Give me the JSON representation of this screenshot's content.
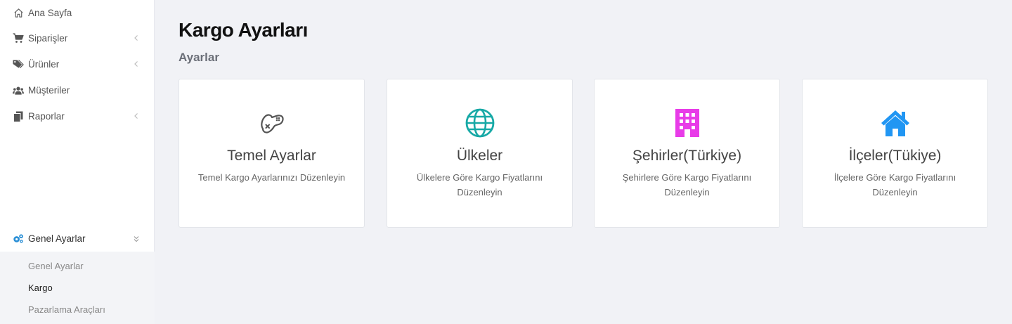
{
  "sidebar": {
    "items": [
      {
        "label": "Ana Sayfa",
        "icon": "home-icon"
      },
      {
        "label": "Siparişler",
        "icon": "cart-icon"
      },
      {
        "label": "Ürünler",
        "icon": "tags-icon"
      },
      {
        "label": "Müşteriler",
        "icon": "users-icon"
      },
      {
        "label": "Raporlar",
        "icon": "copy-icon"
      }
    ],
    "active_group": {
      "label": "Genel Ayarlar",
      "icon": "cogs-icon"
    },
    "sub_items": [
      "Genel Ayarlar",
      "Kargo",
      "Pazarlama Araçları"
    ]
  },
  "main": {
    "title": "Kargo Ayarları",
    "subtitle": "Ayarlar",
    "cards": [
      {
        "title": "Temel Ayarlar",
        "desc": "Temel Kargo Ayarlarınızı Düzenleyin",
        "icon": "gamepad-icon",
        "color": "#555555"
      },
      {
        "title": "Ülkeler",
        "desc": "Ülkelere Göre Kargo Fiyatlarını Düzenleyin",
        "icon": "globe-icon",
        "color": "#17a9a6"
      },
      {
        "title": "Şehirler(Türkiye)",
        "desc": "Şehirlere Göre Kargo Fiyatlarını Düzenleyin",
        "icon": "building-icon",
        "color": "#e83be8"
      },
      {
        "title": "İlçeler(Tükiye)",
        "desc": "İlçelere Göre Kargo Fiyatlarını Düzenleyin",
        "icon": "home-icon",
        "color": "#2196f3"
      }
    ]
  }
}
